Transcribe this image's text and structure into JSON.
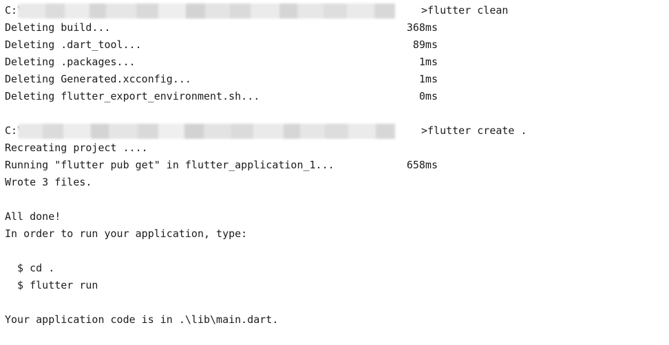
{
  "terminal": {
    "clean_prompt": {
      "drive": "C:\\",
      "command": ">flutter clean"
    },
    "deleting": [
      {
        "text": "Deleting build...",
        "time": "368ms"
      },
      {
        "text": "Deleting .dart_tool...",
        "time": "89ms"
      },
      {
        "text": "Deleting .packages...",
        "time": "1ms"
      },
      {
        "text": "Deleting Generated.xcconfig...",
        "time": "1ms"
      },
      {
        "text": "Deleting flutter_export_environment.sh...",
        "time": "0ms"
      }
    ],
    "create_prompt": {
      "drive": "C:\\",
      "command": ">flutter create ."
    },
    "recreating": "Recreating project ....",
    "pub_get": {
      "text": "Running \"flutter pub get\" in flutter_application_1...",
      "time": "658ms"
    },
    "wrote": "Wrote 3 files.",
    "all_done": "All done!",
    "instructions": "In order to run your application, type:",
    "cmd_cd": "  $ cd .",
    "cmd_run": "  $ flutter run",
    "main_location": "Your application code is in .\\lib\\main.dart."
  }
}
